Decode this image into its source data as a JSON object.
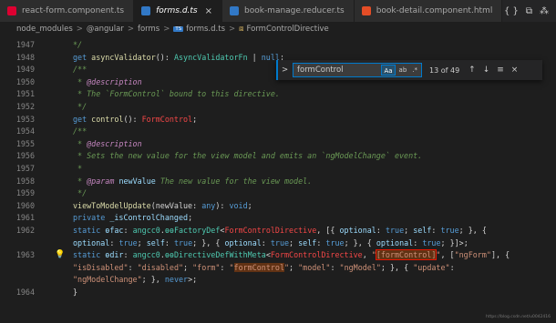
{
  "tabs": [
    {
      "label": "react-form.component.ts",
      "icon": "angular-icon",
      "color": "#dd0031",
      "active": false
    },
    {
      "label": "forms.d.ts",
      "icon": "typescript-icon",
      "color": "#3178c6",
      "active": true,
      "close": "×"
    },
    {
      "label": "book-manage.reducer.ts",
      "icon": "typescript-icon",
      "color": "#3178c6",
      "active": false
    },
    {
      "label": "book-detail.component.html",
      "icon": "html-icon",
      "color": "#e44d26",
      "active": false
    }
  ],
  "tab_actions": {
    "diff": "{ }",
    "split": "⧉",
    "more": "⁂"
  },
  "breadcrumb": {
    "p1": "node_modules",
    "p2": "@angular",
    "p3": "forms",
    "ts_badge": "TS",
    "p4": "forms.d.ts",
    "p5": "FormControlDirective",
    "sep": ">"
  },
  "find": {
    "chevron": ">",
    "query": "formControl",
    "opt_case": "Aa",
    "opt_word": "ab",
    "opt_regex": ".*",
    "count": "13 of 49",
    "up": "↑",
    "down": "↓",
    "selection": "≡",
    "close": "×"
  },
  "lines": [
    {
      "n": "1947",
      "parts": [
        [
          "c",
          "*/"
        ]
      ]
    },
    {
      "n": "1948",
      "parts": [
        [
          "k",
          "get "
        ],
        [
          "f",
          "asyncValidator"
        ],
        [
          "d",
          "(): "
        ],
        [
          "t",
          "AsyncValidatorFn"
        ],
        [
          "d",
          " | "
        ],
        [
          "k",
          "null"
        ],
        [
          "d",
          ";"
        ]
      ]
    },
    {
      "n": "1949",
      "parts": [
        [
          "c",
          "/**"
        ]
      ]
    },
    {
      "n": "1950",
      "parts": [
        [
          "c",
          " * "
        ],
        [
          "tag",
          "@description"
        ]
      ]
    },
    {
      "n": "1951",
      "parts": [
        [
          "c",
          " * The `FormControl` bound to this directive."
        ]
      ]
    },
    {
      "n": "1952",
      "parts": [
        [
          "c",
          " */"
        ]
      ]
    },
    {
      "n": "1953",
      "parts": [
        [
          "k",
          "get "
        ],
        [
          "f",
          "control"
        ],
        [
          "d",
          "(): "
        ],
        [
          "r",
          "FormControl"
        ],
        [
          "d",
          ";"
        ]
      ]
    },
    {
      "n": "1954",
      "parts": [
        [
          "c",
          "/**"
        ]
      ]
    },
    {
      "n": "1955",
      "parts": [
        [
          "c",
          " * "
        ],
        [
          "tag",
          "@description"
        ]
      ]
    },
    {
      "n": "1956",
      "parts": [
        [
          "c",
          " * Sets the new value for the view model and emits an `ngModelChange` event."
        ]
      ]
    },
    {
      "n": "1957",
      "parts": [
        [
          "c",
          " *"
        ]
      ]
    },
    {
      "n": "1958",
      "parts": [
        [
          "c",
          " * "
        ],
        [
          "tag",
          "@param "
        ],
        [
          "p",
          "newValue"
        ],
        [
          "c",
          " The new value for the view model."
        ]
      ]
    },
    {
      "n": "1959",
      "parts": [
        [
          "c",
          " */"
        ]
      ]
    },
    {
      "n": "1960",
      "parts": [
        [
          "f",
          "viewToModelUpdate"
        ],
        [
          "d",
          "(newValue: "
        ],
        [
          "k",
          "any"
        ],
        [
          "d",
          "): "
        ],
        [
          "k",
          "void"
        ],
        [
          "d",
          ";"
        ]
      ]
    },
    {
      "n": "1961",
      "parts": [
        [
          "k",
          "private "
        ],
        [
          "p",
          "_isControlChanged"
        ],
        [
          "d",
          ";"
        ]
      ]
    },
    {
      "n": "1962",
      "parts": [
        [
          "k",
          "static "
        ],
        [
          "p",
          "ɵfac"
        ],
        [
          "d",
          ": "
        ],
        [
          "t",
          "angcc0"
        ],
        [
          "d",
          "."
        ],
        [
          "t",
          "ɵɵFactoryDef"
        ],
        [
          "d",
          "<"
        ],
        [
          "r",
          "FormControlDirective"
        ],
        [
          "d",
          ", [{ "
        ],
        [
          "p",
          "optional"
        ],
        [
          "d",
          ": "
        ],
        [
          "k",
          "true"
        ],
        [
          "d",
          "; "
        ],
        [
          "p",
          "self"
        ],
        [
          "d",
          ": "
        ],
        [
          "k",
          "true"
        ],
        [
          "d",
          "; }, {"
        ]
      ]
    },
    {
      "n": "",
      "parts": [
        [
          "p",
          "optional"
        ],
        [
          "d",
          ": "
        ],
        [
          "k",
          "true"
        ],
        [
          "d",
          "; "
        ],
        [
          "p",
          "self"
        ],
        [
          "d",
          ": "
        ],
        [
          "k",
          "true"
        ],
        [
          "d",
          "; }, { "
        ],
        [
          "p",
          "optional"
        ],
        [
          "d",
          ": "
        ],
        [
          "k",
          "true"
        ],
        [
          "d",
          "; "
        ],
        [
          "p",
          "self"
        ],
        [
          "d",
          ": "
        ],
        [
          "k",
          "true"
        ],
        [
          "d",
          "; }, { "
        ],
        [
          "p",
          "optional"
        ],
        [
          "d",
          ": "
        ],
        [
          "k",
          "true"
        ],
        [
          "d",
          "; }]>;"
        ]
      ]
    },
    {
      "n": "1963",
      "bulb": true,
      "parts": [
        [
          "k",
          "static "
        ],
        [
          "p",
          "ɵdir"
        ],
        [
          "d",
          ": "
        ],
        [
          "t",
          "angcc0"
        ],
        [
          "d",
          "."
        ],
        [
          "t",
          "ɵɵDirectiveDefWithMeta"
        ],
        [
          "d",
          "<"
        ],
        [
          "r",
          "FormControlDirective"
        ],
        [
          "d",
          ", "
        ],
        [
          "s",
          "\""
        ],
        [
          "sbox",
          "[formControl]"
        ],
        [
          "s",
          "\""
        ],
        [
          "d",
          ", ["
        ],
        [
          "s",
          "\"ngForm\""
        ],
        [
          "d",
          "], {"
        ]
      ]
    },
    {
      "n": "",
      "parts": [
        [
          "s",
          "\"isDisabled\""
        ],
        [
          "d",
          ": "
        ],
        [
          "s",
          "\"disabled\""
        ],
        [
          "d",
          "; "
        ],
        [
          "s",
          "\"form\""
        ],
        [
          "d",
          ": "
        ],
        [
          "s",
          "\""
        ],
        [
          "shl",
          "formControl"
        ],
        [
          "s",
          "\""
        ],
        [
          "d",
          "; "
        ],
        [
          "s",
          "\"model\""
        ],
        [
          "d",
          ": "
        ],
        [
          "s",
          "\"ngModel\""
        ],
        [
          "d",
          "; }, { "
        ],
        [
          "s",
          "\"update\""
        ],
        [
          "d",
          ":"
        ]
      ]
    },
    {
      "n": "",
      "parts": [
        [
          "s",
          "\"ngModelChange\""
        ],
        [
          "d",
          "; }, "
        ],
        [
          "k",
          "never"
        ],
        [
          "d",
          ">;"
        ]
      ]
    },
    {
      "n": "1964",
      "parts": [
        [
          "d",
          "}"
        ]
      ]
    }
  ],
  "bulb_glyph": "💡",
  "watermark": "https://blog.csdn.net/u0042416"
}
